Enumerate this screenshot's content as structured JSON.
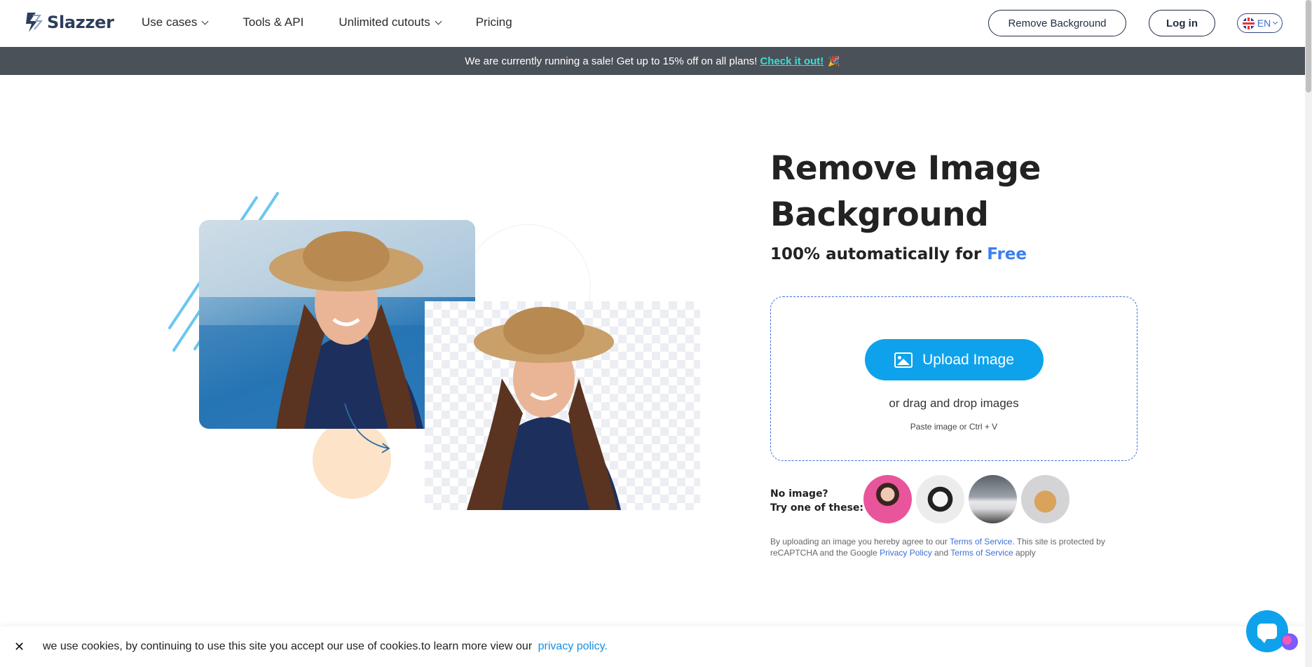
{
  "header": {
    "logo_text": "Slazzer",
    "nav": [
      {
        "label": "Use cases",
        "has_dropdown": true
      },
      {
        "label": "Tools & API",
        "has_dropdown": false
      },
      {
        "label": "Unlimited cutouts",
        "has_dropdown": true
      },
      {
        "label": "Pricing",
        "has_dropdown": false
      }
    ],
    "remove_bg_label": "Remove Background",
    "login_label": "Log in",
    "language": "EN"
  },
  "promo": {
    "text": "We are currently running a sale! Get up to 15% off on all plans!",
    "link": "Check it out!",
    "emoji": "🎉"
  },
  "hero": {
    "title": "Remove Image Background",
    "subtitle_prefix": "100% automatically for",
    "subtitle_highlight": "Free",
    "upload_label": "Upload Image",
    "drag_text": "or drag and drop images",
    "paste_text": "Paste image or Ctrl + V",
    "try_line1": "No image?",
    "try_line2": "Try one of these:",
    "samples": [
      "woman-sample",
      "headphones-sample",
      "car-sample",
      "dog-sample"
    ]
  },
  "legal": {
    "t1": "By uploading an image you hereby agree to our",
    "terms1": "Terms of Service",
    "t2": ". This site is protected by reCAPTCHA and the Google",
    "privacy": "Privacy Policy",
    "t3": "and",
    "terms2": "Terms of Service",
    "t4": "apply"
  },
  "cookie": {
    "close": "✕",
    "text": "we use cookies, by continuing to use this site you accept our use of cookies.to learn more view our",
    "link": "privacy policy."
  },
  "colors": {
    "accent": "#0ea2ec",
    "link": "#3b6fd8",
    "promo_bg": "#4b5159",
    "promo_link": "#35e0d2",
    "free_highlight": "#3b7ff0"
  }
}
